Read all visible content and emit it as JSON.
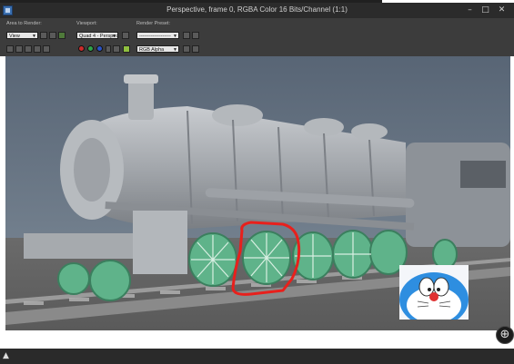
{
  "window": {
    "title": "Perspective, frame 0, RGBA Color 16 Bits/Channel (1:1)",
    "controls": [
      "–",
      "□",
      "✕"
    ]
  },
  "toolbar": {
    "area_to_render": {
      "label": "Area to Render:",
      "value": "View"
    },
    "viewport": {
      "label": "Viewport:",
      "value": "Quad 4 - Perspec"
    },
    "render_preset": {
      "label": "Render Preset:",
      "value": "-------------------"
    },
    "channel": {
      "value": "RGB Alpha"
    },
    "channel_colors": [
      "#cc2b2b",
      "#2fa34a",
      "#2b54c7"
    ],
    "swatch_color": "#8fbf3f"
  },
  "viewport_render": {
    "subject": "steam-locomotive",
    "annotation": "red-freehand-circle",
    "annotation_color": "#e8201c",
    "wheel_color": "#5fb38a",
    "body_color": "#9aa0a6",
    "sky_color": "#6f7d8c"
  },
  "overlay_image": {
    "subject": "cartoon-cat-face"
  },
  "zoom_button": {
    "icon": "zoom-in-icon"
  }
}
